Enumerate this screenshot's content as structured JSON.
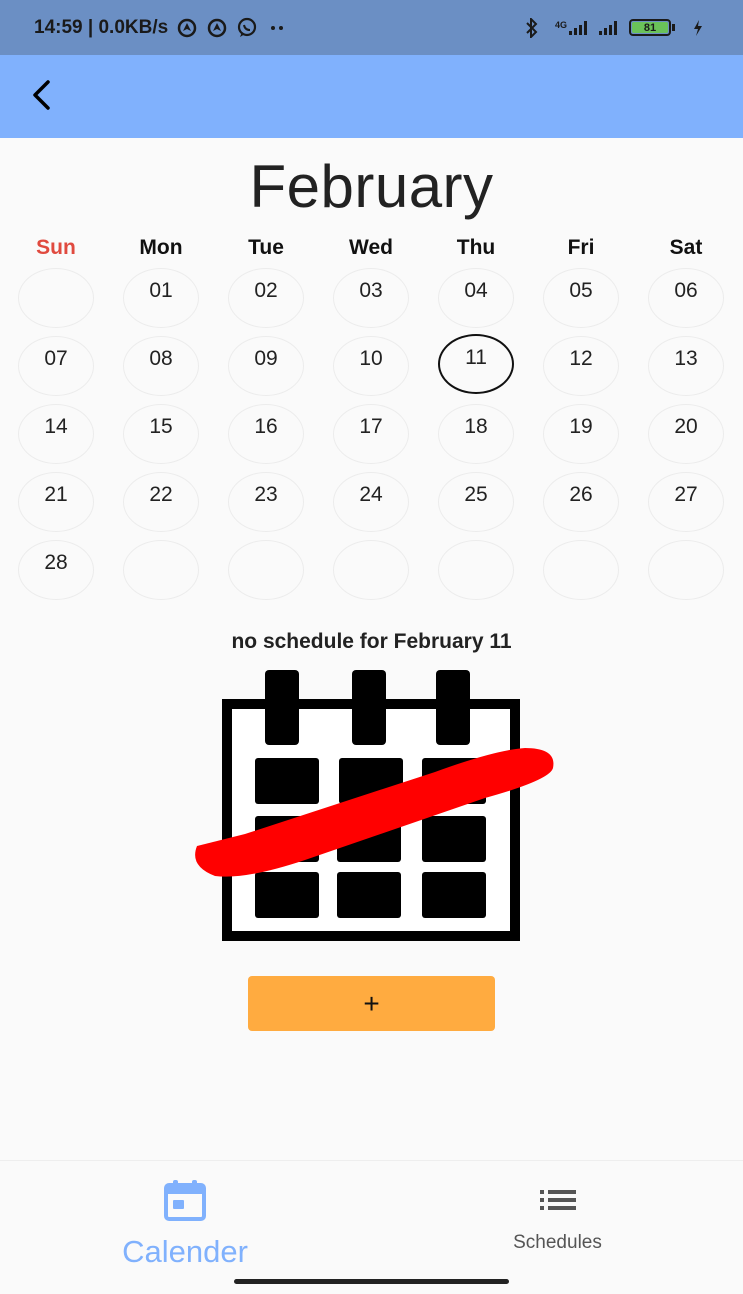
{
  "status_bar": {
    "time_and_speed": "14:59 | 0.0KB/s",
    "network_label": "4G",
    "battery_level": "81",
    "icons": [
      "gps-icon",
      "gps-icon",
      "whatsapp-icon",
      "more-dots-icon",
      "bluetooth-icon",
      "signal-icon",
      "signal-icon",
      "charging-icon"
    ]
  },
  "app_bar": {
    "back_icon": "back-arrow-icon",
    "color": "#80b1fd"
  },
  "calendar": {
    "month": "February",
    "weekdays": [
      "Sun",
      "Mon",
      "Tue",
      "Wed",
      "Thu",
      "Fri",
      "Sat"
    ],
    "weeks": [
      [
        "",
        "01",
        "02",
        "03",
        "04",
        "05",
        "06"
      ],
      [
        "07",
        "08",
        "09",
        "10",
        "11",
        "12",
        "13"
      ],
      [
        "14",
        "15",
        "16",
        "17",
        "18",
        "19",
        "20"
      ],
      [
        "21",
        "22",
        "23",
        "24",
        "25",
        "26",
        "27"
      ],
      [
        "28",
        "",
        "",
        "",
        "",
        "",
        ""
      ]
    ],
    "selected_day": "11",
    "sunday_color": "#e04a3f"
  },
  "schedule": {
    "empty_message": "no schedule for February 11",
    "illustration_icon": "no-events-calendar-icon",
    "add_button_label": "+",
    "add_button_color": "#ffab40"
  },
  "bottom_nav": {
    "items": [
      {
        "label": "Calender",
        "icon": "calendar-icon",
        "active": true
      },
      {
        "label": "Schedules",
        "icon": "list-icon",
        "active": false
      }
    ],
    "active_color": "#80b1fd"
  }
}
